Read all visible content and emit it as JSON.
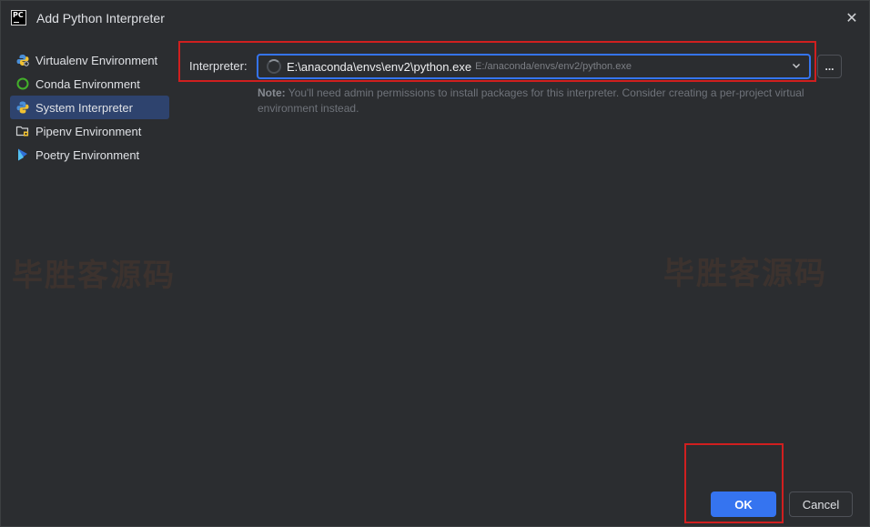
{
  "window": {
    "title": "Add Python Interpreter",
    "close_glyph": "✕",
    "app_icon_text": "PC"
  },
  "sidebar": {
    "items": [
      {
        "label": "Virtualenv Environment",
        "icon": "virtualenv-icon"
      },
      {
        "label": "Conda Environment",
        "icon": "conda-icon"
      },
      {
        "label": "System Interpreter",
        "icon": "python-icon",
        "selected": true
      },
      {
        "label": "Pipenv Environment",
        "icon": "pipenv-icon"
      },
      {
        "label": "Poetry Environment",
        "icon": "poetry-icon"
      }
    ]
  },
  "interpreter": {
    "label": "Interpreter:",
    "value": "E:\\anaconda\\envs\\env2\\python.exe",
    "hint": "E:/anaconda/envs/env2/python.exe",
    "browse_label": "..."
  },
  "note": {
    "prefix": "Note:",
    "text": " You'll need admin permissions to install packages for this interpreter. Consider creating a per-project virtual environment instead."
  },
  "watermark": {
    "left": "毕胜客源码",
    "right": "毕胜客源码"
  },
  "buttons": {
    "ok": "OK",
    "cancel": "Cancel"
  },
  "colors": {
    "background": "#2b2d30",
    "accent": "#3574f0",
    "selection": "#2e436e",
    "annotation": "#d01f1f"
  }
}
